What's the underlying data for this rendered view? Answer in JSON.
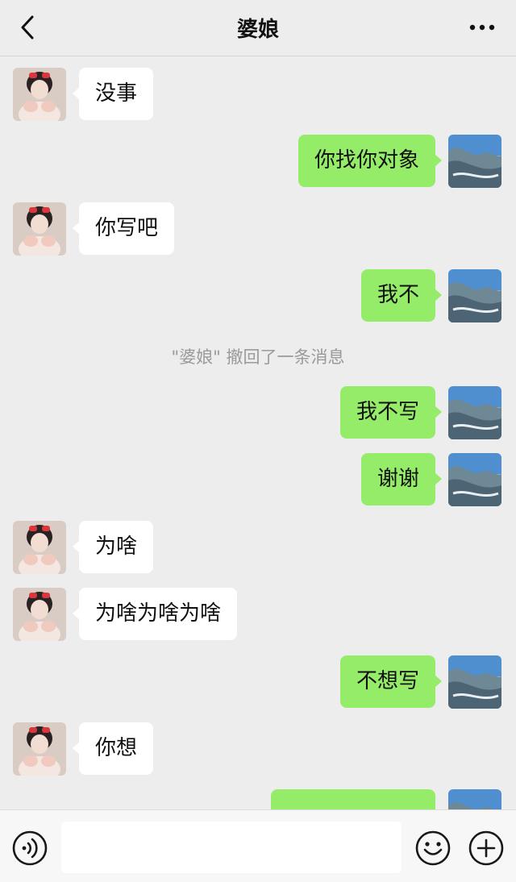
{
  "header": {
    "title": "婆娘"
  },
  "icons": {
    "back": "chevron-left-icon",
    "more": "more-horizontal-icon",
    "voice": "voice-icon",
    "emoji": "emoji-icon",
    "plus": "plus-icon"
  },
  "colors": {
    "background": "#ededed",
    "sent_bubble": "#95ec69",
    "received_bubble": "#ffffff",
    "system_text": "#9a9a9a"
  },
  "messages": [
    {
      "side": "left",
      "text": "没事"
    },
    {
      "side": "right",
      "text": "你找你对象"
    },
    {
      "side": "left",
      "text": "你写吧"
    },
    {
      "side": "right",
      "text": "我不"
    },
    {
      "side": "system",
      "text": "\"婆娘\" 撤回了一条消息"
    },
    {
      "side": "right",
      "text": "我不写"
    },
    {
      "side": "right",
      "text": "谢谢"
    },
    {
      "side": "left",
      "text": "为啥"
    },
    {
      "side": "left",
      "text": "为啥为啥为啥"
    },
    {
      "side": "right",
      "text": "不想写"
    },
    {
      "side": "left",
      "text": "你想"
    },
    {
      "side": "right",
      "text": ""
    }
  ],
  "input": {
    "value": ""
  }
}
